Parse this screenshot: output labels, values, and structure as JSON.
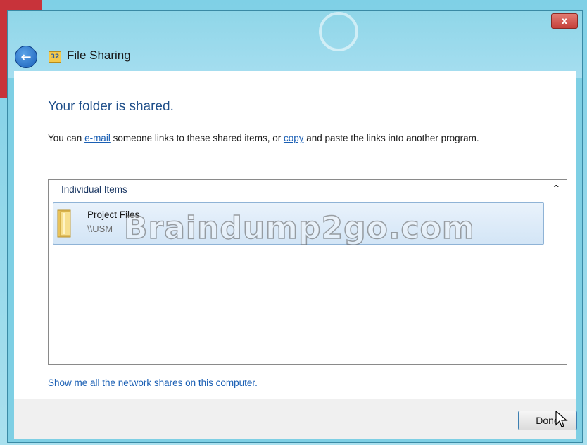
{
  "window": {
    "title": "File Sharing",
    "close_label": "x",
    "app_icon_glyph": "32"
  },
  "main": {
    "heading": "Your folder is shared.",
    "desc_prefix": "You can ",
    "email_link": "e-mail",
    "desc_middle": " someone links to these shared items, or ",
    "copy_link": "copy",
    "desc_suffix": " and paste the links into another program."
  },
  "items": {
    "group_label": "Individual Items",
    "collapse_glyph": "^",
    "rows": [
      {
        "name": "Project Files",
        "path": "\\\\USM"
      }
    ]
  },
  "watermark": "Braindump2go.com",
  "network_link": "Show me all the network shares on this computer.",
  "footer": {
    "done_label": "Done"
  },
  "colors": {
    "accent": "#1a5fb4",
    "heading": "#1f4f8a",
    "selection": "#d3e5f6"
  },
  "icons": [
    "back-arrow-icon",
    "file-sharing-icon",
    "close-icon",
    "folder-icon",
    "chevron-up-icon",
    "mouse-cursor-icon"
  ]
}
